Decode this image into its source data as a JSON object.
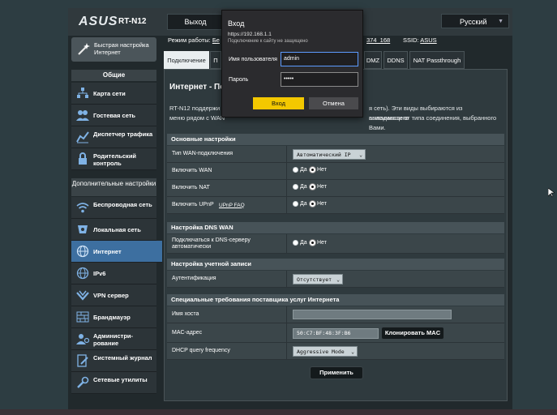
{
  "header": {
    "logo": "ASUS",
    "model": "RT-N12",
    "logout_label": "Выход",
    "language": "Русский"
  },
  "quick_setup": {
    "label": "Быстрая настройка Интернет"
  },
  "status": {
    "mode_prefix": "Режим работы:",
    "mode_value": "Бе",
    "firmware": "374_168",
    "ssid_label": "SSID:",
    "ssid_value": "ASUS"
  },
  "sidebar": {
    "general_header": "Общие",
    "general_items": [
      {
        "label": "Карта сети",
        "icon": "network-map-icon"
      },
      {
        "label": "Гостевая сеть",
        "icon": "guest-network-icon"
      },
      {
        "label": "Диспетчер трафика",
        "icon": "traffic-manager-icon"
      },
      {
        "label": "Родительский контроль",
        "icon": "parental-lock-icon"
      }
    ],
    "advanced_header": "Дополнительные настройки",
    "advanced_items": [
      {
        "label": "Беспроводная сеть",
        "icon": "wireless-icon"
      },
      {
        "label": "Локальная сеть",
        "icon": "lan-icon"
      },
      {
        "label": "Интернет",
        "icon": "globe-icon"
      },
      {
        "label": "IPv6",
        "icon": "ipv6-globe-icon"
      },
      {
        "label": "VPN сервер",
        "icon": "vpn-icon"
      },
      {
        "label": "Брандмауэр",
        "icon": "firewall-icon"
      },
      {
        "label": "Администри-рование",
        "icon": "admin-icon"
      },
      {
        "label": "Системный журнал",
        "icon": "system-log-icon"
      },
      {
        "label": "Сетевые утилиты",
        "icon": "network-tools-icon"
      }
    ]
  },
  "tabs": [
    {
      "label": "Подключение"
    },
    {
      "label": "П"
    },
    {
      "label": "DMZ"
    },
    {
      "label": "DDNS"
    },
    {
      "label": "NAT Passthrough"
    }
  ],
  "panel": {
    "title": "Интернет - Под",
    "desc_line1_start": "RT-N12 поддержи",
    "desc_line1_end": "я сеть). Эти виды выбираются из выпадающего",
    "desc_line2_start": "меню рядом с WAN",
    "desc_line2_end": "ависимости от типа соединения, выбранного Вами."
  },
  "basic": {
    "header": "Основные настройки",
    "wan_type_label": "Тип WAN-подключения",
    "wan_type_value": "Автоматический IP",
    "enable_wan_label": "Включить WAN",
    "enable_nat_label": "Включить NAT",
    "enable_upnp_label": "Включить UPnP",
    "upnp_faq": "UPnP FAQ",
    "yes": "Да",
    "no": "Нет"
  },
  "dns": {
    "header": "Настройка DNS WAN",
    "auto_dns_label": "Подключаться к DNS-серверу автоматически"
  },
  "account": {
    "header": "Настройка учетной записи",
    "auth_label": "Аутентификация",
    "auth_value": "Отсутствует"
  },
  "isp": {
    "header": "Специальные требования поставщика услуг Интернета",
    "hostname_label": "Имя хоста",
    "hostname_value": "",
    "mac_label": "MAC-адрес",
    "mac_value": "50:C7:BF:48:3F:B6",
    "clone_mac_label": "Клонировать MAC",
    "dhcp_label": "DHCP query frequency",
    "dhcp_value": "Aggressive Mode"
  },
  "apply_label": "Применить",
  "login_dialog": {
    "title": "Вход",
    "url": "https://192.168.1.1",
    "warning": "Подключение к сайту не защищено",
    "username_label": "Имя пользователя",
    "username_value": "admin",
    "password_label": "Пароль",
    "password_value": "•••••",
    "ok_label": "Вход",
    "cancel_label": "Отмена"
  }
}
